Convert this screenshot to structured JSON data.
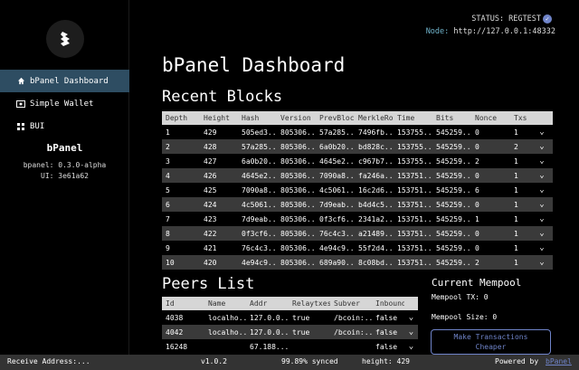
{
  "sidebar": {
    "items": [
      {
        "label": "bPanel Dashboard",
        "icon": "home-icon"
      },
      {
        "label": "Simple Wallet",
        "icon": "wallet-icon"
      },
      {
        "label": "BUI",
        "icon": "grid-icon"
      }
    ],
    "app_name": "bPanel",
    "version_line": "bpanel: 0.3.0-alpha",
    "ui_line": "UI: 3e61a62"
  },
  "header": {
    "status": "STATUS: REGTEST",
    "node_label": "Node:",
    "node_url": "http://127.0.0.1:48332"
  },
  "main": {
    "title": "bPanel Dashboard",
    "recent_blocks_title": "Recent Blocks",
    "peers_title": "Peers List"
  },
  "blocks": {
    "columns": [
      "Depth",
      "Height",
      "Hash",
      "Version",
      "PrevBlock",
      "MerkleRoot",
      "Time",
      "Bits",
      "Nonce",
      "Txs"
    ],
    "rows": [
      [
        "1",
        "429",
        "505ed3...",
        "805306...",
        "57a285...",
        "7496fb...",
        "153755...",
        "545259...",
        "0",
        "1"
      ],
      [
        "2",
        "428",
        "57a285...",
        "805306...",
        "6a0b20...",
        "bd828c...",
        "153755...",
        "545259...",
        "0",
        "2"
      ],
      [
        "3",
        "427",
        "6a0b20...",
        "805306...",
        "4645e2...",
        "c967b7...",
        "153755...",
        "545259...",
        "2",
        "1"
      ],
      [
        "4",
        "426",
        "4645e2...",
        "805306...",
        "7090a8...",
        "fa246a...",
        "153751...",
        "545259...",
        "0",
        "1"
      ],
      [
        "5",
        "425",
        "7090a8...",
        "805306...",
        "4c5061...",
        "16c2d6...",
        "153751...",
        "545259...",
        "6",
        "1"
      ],
      [
        "6",
        "424",
        "4c5061...",
        "805306...",
        "7d9eab...",
        "b4d4c5...",
        "153751...",
        "545259...",
        "0",
        "1"
      ],
      [
        "7",
        "423",
        "7d9eab...",
        "805306...",
        "0f3cf6...",
        "2341a2...",
        "153751...",
        "545259...",
        "1",
        "1"
      ],
      [
        "8",
        "422",
        "0f3cf6...",
        "805306...",
        "76c4c3...",
        "a21489...",
        "153751...",
        "545259...",
        "0",
        "1"
      ],
      [
        "9",
        "421",
        "76c4c3...",
        "805306...",
        "4e94c9...",
        "55f2d4...",
        "153751...",
        "545259...",
        "0",
        "1"
      ],
      [
        "10",
        "420",
        "4e94c9...",
        "805306...",
        "689a90...",
        "8c08bd...",
        "153751...",
        "545259...",
        "2",
        "1"
      ]
    ]
  },
  "peers": {
    "columns": [
      "Id",
      "Name",
      "Addr",
      "Relaytxes",
      "Subver",
      "Inbound"
    ],
    "rows": [
      [
        "4038",
        "localho...",
        "127.0.0...",
        "true",
        "/bcoin:...",
        "false"
      ],
      [
        "4042",
        "localho...",
        "127.0.0...",
        "true",
        "/bcoin:...",
        "false"
      ],
      [
        "16248",
        "",
        "67.188...",
        "",
        "",
        "false"
      ]
    ]
  },
  "mempool": {
    "title": "Current Mempool",
    "tx_line": "Mempool TX: 0",
    "size_line": "Mempool Size: 0",
    "button_line1": "Make Transactions",
    "button_line2": "Cheaper"
  },
  "footer": {
    "receive": "Receive Address:...",
    "version": "v1.0.2",
    "synced": "99.89% synced",
    "height": "height: 429",
    "powered_by": "Powered by",
    "powered_link": "bPanel"
  },
  "colors": {
    "accent": "#6f84c9",
    "active_nav": "#2e4d62",
    "row_alt": "#3a3a3a",
    "header_bg": "#d6d6d6"
  }
}
